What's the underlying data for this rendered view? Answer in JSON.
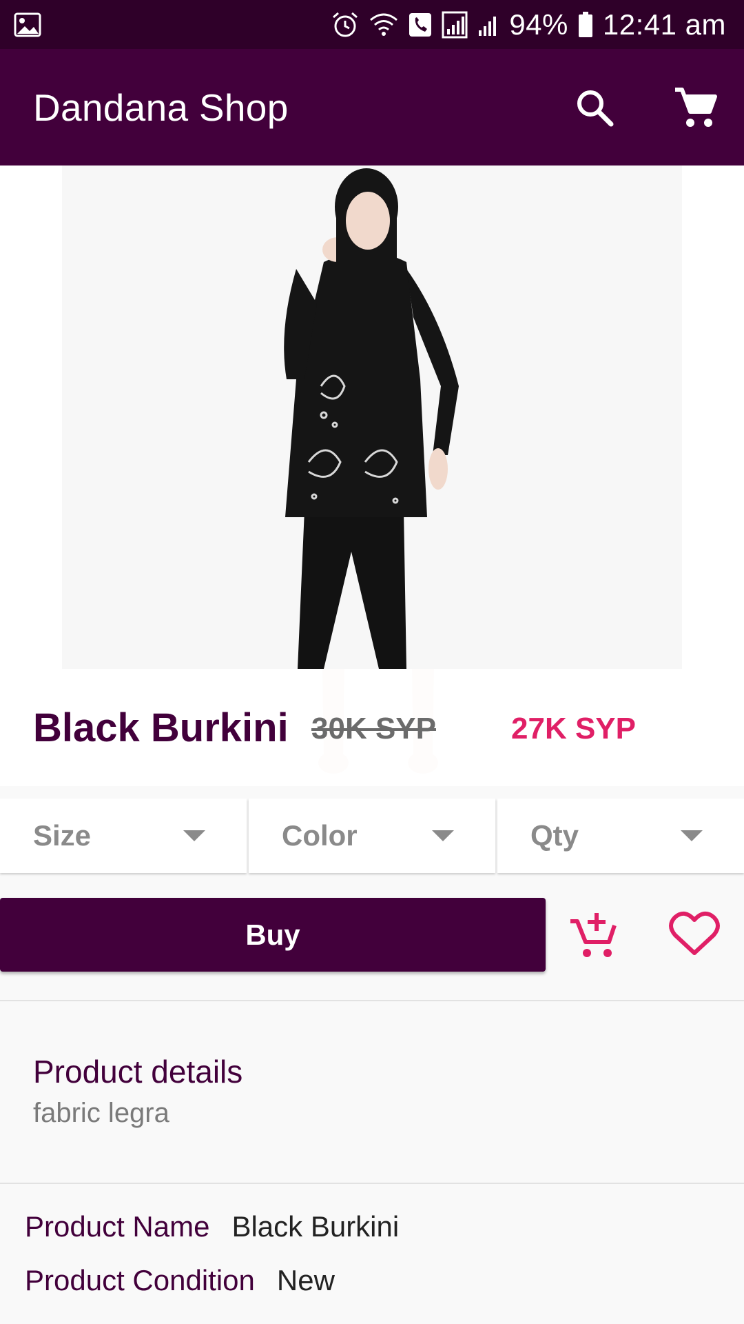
{
  "status_bar": {
    "battery": "94%",
    "time": "12:41 am",
    "icons": [
      "image-icon",
      "alarm-icon",
      "wifi-icon",
      "phone-icon",
      "signal-icon",
      "signal-icon-2",
      "battery-icon"
    ]
  },
  "app_bar": {
    "title": "Dandana Shop",
    "actions": [
      "search-icon",
      "cart-icon"
    ]
  },
  "product": {
    "name": "Black Burkini",
    "old_price": "30K SYP",
    "new_price": "27K SYP",
    "image": "product-photo"
  },
  "selectors": [
    {
      "label": "Size"
    },
    {
      "label": "Color"
    },
    {
      "label": "Qty"
    }
  ],
  "actions": {
    "buy_label": "Buy",
    "add_to_cart_icon": "add-shopping-cart-icon",
    "favorite_icon": "heart-outline-icon"
  },
  "details": {
    "title": "Product details",
    "text": "fabric legra"
  },
  "specs": [
    {
      "label": "Product Name",
      "value": "Black Burkini"
    },
    {
      "label": "Product Condition",
      "value": "New"
    }
  ],
  "colors": {
    "status_bar": "#2f0029",
    "primary": "#42003b",
    "accent": "#e01f66",
    "muted": "#8a8a8a"
  }
}
